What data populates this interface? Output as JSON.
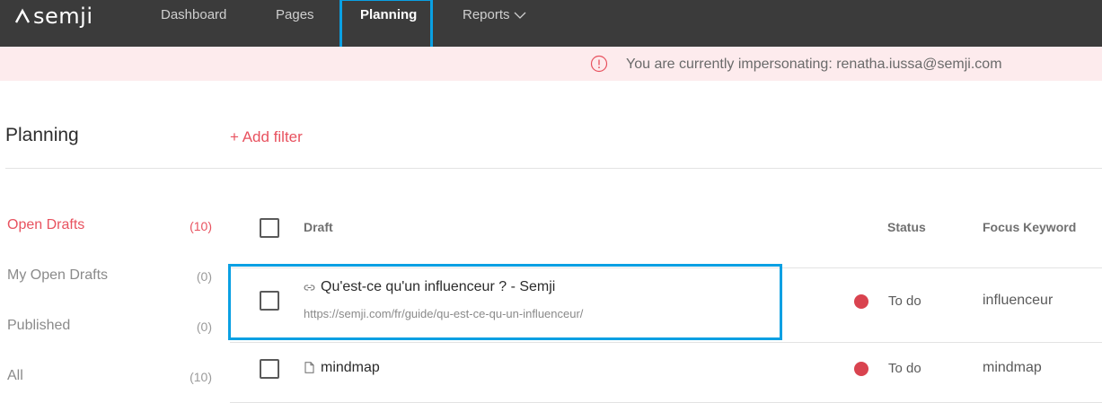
{
  "app": {
    "logo_text": "semji"
  },
  "nav": {
    "items": [
      {
        "label": "Dashboard",
        "active": false
      },
      {
        "label": "Pages",
        "active": false
      },
      {
        "label": "Planning",
        "active": true
      },
      {
        "label": "Reports",
        "active": false,
        "has_dropdown": true
      }
    ]
  },
  "banner": {
    "icon": "info-circle-icon",
    "text": "You are currently impersonating: renatha.iussa@semji.com"
  },
  "header": {
    "title": "Planning",
    "add_filter_label": "+ Add filter"
  },
  "sidebar": {
    "items": [
      {
        "label": "Open Drafts",
        "count": "(10)",
        "active": true
      },
      {
        "label": "My Open Drafts",
        "count": "(0)",
        "active": false
      },
      {
        "label": "Published",
        "count": "(0)",
        "active": false
      },
      {
        "label": "All",
        "count": "(10)",
        "active": false
      }
    ]
  },
  "table": {
    "columns": {
      "draft": "Draft",
      "status": "Status",
      "focus_keyword": "Focus Keyword"
    },
    "rows": [
      {
        "icon": "link-icon",
        "title": "Qu'est-ce qu'un influenceur ? - Semji",
        "url": "https://semji.com/fr/guide/qu-est-ce-qu-un-influenceur/",
        "status": "To do",
        "keyword": "influenceur"
      },
      {
        "icon": "document-icon",
        "title": "mindmap",
        "url": "",
        "status": "To do",
        "keyword": "mindmap"
      }
    ]
  },
  "colors": {
    "nav_bg": "#3b3b3b",
    "banner_bg": "#fdebed",
    "accent": "#e8525f",
    "status_todo": "#d9434f",
    "highlight": "#0aa0e3"
  }
}
